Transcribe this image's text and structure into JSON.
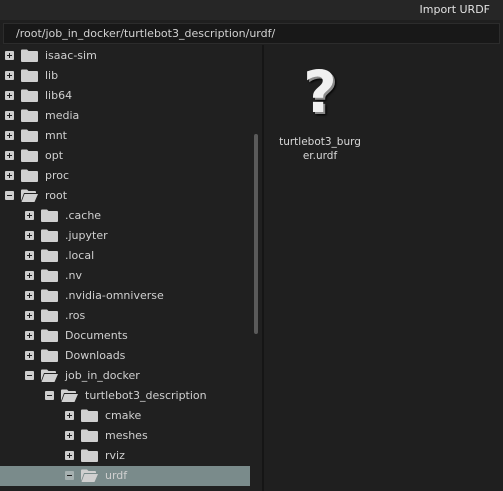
{
  "window": {
    "title": "Import URDF"
  },
  "path": {
    "value": "/root/job_in_docker/turtlebot3_description/urdf/"
  },
  "tree": {
    "rows": [
      {
        "label": "isaac-sim",
        "indent": 0,
        "expanded": false,
        "selected": false
      },
      {
        "label": "lib",
        "indent": 0,
        "expanded": false,
        "selected": false
      },
      {
        "label": "lib64",
        "indent": 0,
        "expanded": false,
        "selected": false
      },
      {
        "label": "media",
        "indent": 0,
        "expanded": false,
        "selected": false
      },
      {
        "label": "mnt",
        "indent": 0,
        "expanded": false,
        "selected": false
      },
      {
        "label": "opt",
        "indent": 0,
        "expanded": false,
        "selected": false
      },
      {
        "label": "proc",
        "indent": 0,
        "expanded": false,
        "selected": false
      },
      {
        "label": "root",
        "indent": 0,
        "expanded": true,
        "selected": false
      },
      {
        "label": ".cache",
        "indent": 1,
        "expanded": false,
        "selected": false
      },
      {
        "label": ".jupyter",
        "indent": 1,
        "expanded": false,
        "selected": false
      },
      {
        "label": ".local",
        "indent": 1,
        "expanded": false,
        "selected": false
      },
      {
        "label": ".nv",
        "indent": 1,
        "expanded": false,
        "selected": false
      },
      {
        "label": ".nvidia-omniverse",
        "indent": 1,
        "expanded": false,
        "selected": false
      },
      {
        "label": ".ros",
        "indent": 1,
        "expanded": false,
        "selected": false
      },
      {
        "label": "Documents",
        "indent": 1,
        "expanded": false,
        "selected": false
      },
      {
        "label": "Downloads",
        "indent": 1,
        "expanded": false,
        "selected": false
      },
      {
        "label": "job_in_docker",
        "indent": 1,
        "expanded": true,
        "selected": false
      },
      {
        "label": "turtlebot3_description",
        "indent": 2,
        "expanded": true,
        "selected": false
      },
      {
        "label": "cmake",
        "indent": 3,
        "expanded": false,
        "selected": false
      },
      {
        "label": "meshes",
        "indent": 3,
        "expanded": false,
        "selected": false
      },
      {
        "label": "rviz",
        "indent": 3,
        "expanded": false,
        "selected": false
      },
      {
        "label": "urdf",
        "indent": 3,
        "expanded": true,
        "selected": true
      }
    ]
  },
  "files": [
    {
      "name": "turtlebot3_burger.urdf",
      "icon": "unknown-file-question-icon"
    }
  ],
  "colors": {
    "selection": "#7a8b8b",
    "background": "#1f1f1f"
  }
}
